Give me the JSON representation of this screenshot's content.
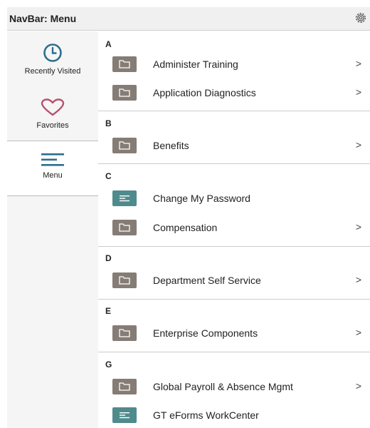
{
  "header": {
    "title": "NavBar: Menu",
    "gear_icon": "gear-icon"
  },
  "sidebar": {
    "items": [
      {
        "label": "Recently Visited",
        "icon": "clock-icon",
        "color": "#2d6e8e"
      },
      {
        "label": "Favorites",
        "icon": "heart-icon",
        "color": "#b5516f"
      },
      {
        "label": "Menu",
        "icon": "hamburger-menu-icon",
        "color": "#2d6e8e",
        "active": true
      }
    ]
  },
  "menu": {
    "sections": [
      {
        "letter": "A",
        "items": [
          {
            "label": "Administer Training",
            "type": "folder",
            "chevron": ">"
          },
          {
            "label": "Application Diagnostics",
            "type": "folder",
            "chevron": ">"
          }
        ]
      },
      {
        "letter": "B",
        "items": [
          {
            "label": "Benefits",
            "type": "folder",
            "chevron": ">"
          }
        ]
      },
      {
        "letter": "C",
        "items": [
          {
            "label": "Change My Password",
            "type": "page",
            "chevron": ""
          },
          {
            "label": "Compensation",
            "type": "folder",
            "chevron": ">"
          }
        ]
      },
      {
        "letter": "D",
        "items": [
          {
            "label": "Department Self Service",
            "type": "folder",
            "chevron": ">"
          }
        ]
      },
      {
        "letter": "E",
        "items": [
          {
            "label": "Enterprise Components",
            "type": "folder",
            "chevron": ">"
          }
        ]
      },
      {
        "letter": "G",
        "items": [
          {
            "label": "Global Payroll & Absence Mgmt",
            "type": "folder",
            "chevron": ">"
          },
          {
            "label": "GT eForms WorkCenter",
            "type": "page",
            "chevron": ""
          }
        ]
      }
    ]
  },
  "colors": {
    "folder": "#857c75",
    "page": "#4f8b8c",
    "accent": "#2d6e8e",
    "favorite": "#b5516f"
  }
}
